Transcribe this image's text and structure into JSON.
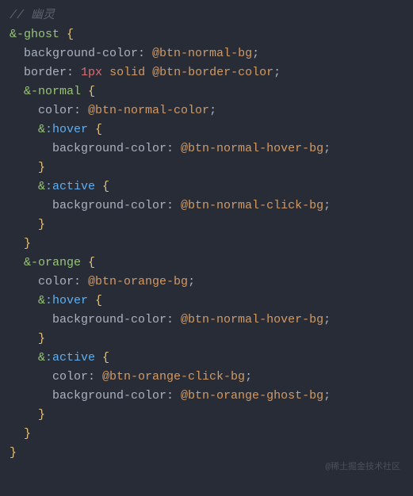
{
  "comment": "// 幽灵",
  "lines": {
    "l1_sel": "&-ghost",
    "l1_brace": " {",
    "l2_prop": "background-color",
    "l2_val": "@btn-normal-bg",
    "l3_prop": "border",
    "l3_num": "1px",
    "l3_kw": "solid",
    "l3_val": "@btn-border-color",
    "l4_sel": "&-normal",
    "l4_brace": " {",
    "l5_prop": "color",
    "l5_val": "@btn-normal-color",
    "l6_amp": "&",
    "l6_pseudo": ":hover",
    "l6_brace": " {",
    "l7_prop": "background-color",
    "l7_val": "@btn-normal-hover-bg",
    "l8_brace": "}",
    "l9_amp": "&",
    "l9_pseudo": ":active",
    "l9_brace": " {",
    "l10_prop": "background-color",
    "l10_val": "@btn-normal-click-bg",
    "l11_brace": "}",
    "l12_brace": "}",
    "l13_sel": "&-orange",
    "l13_brace": " {",
    "l14_prop": "color",
    "l14_val": "@btn-orange-bg",
    "l15_amp": "&",
    "l15_pseudo": ":hover",
    "l15_brace": " {",
    "l16_prop": "background-color",
    "l16_val": "@btn-normal-hover-bg",
    "l17_brace": "}",
    "l18_amp": "&",
    "l18_pseudo": ":active",
    "l18_brace": " {",
    "l19_prop": "color",
    "l19_val": "@btn-orange-click-bg",
    "l20_prop": "background-color",
    "l20_val": "@btn-orange-ghost-bg",
    "l21_brace": "}",
    "l22_brace": "}",
    "l23_brace": "}"
  },
  "punct": {
    "colon": ": ",
    "semi": ";",
    "sp": " "
  },
  "watermark": "@稀土掘金技术社区"
}
